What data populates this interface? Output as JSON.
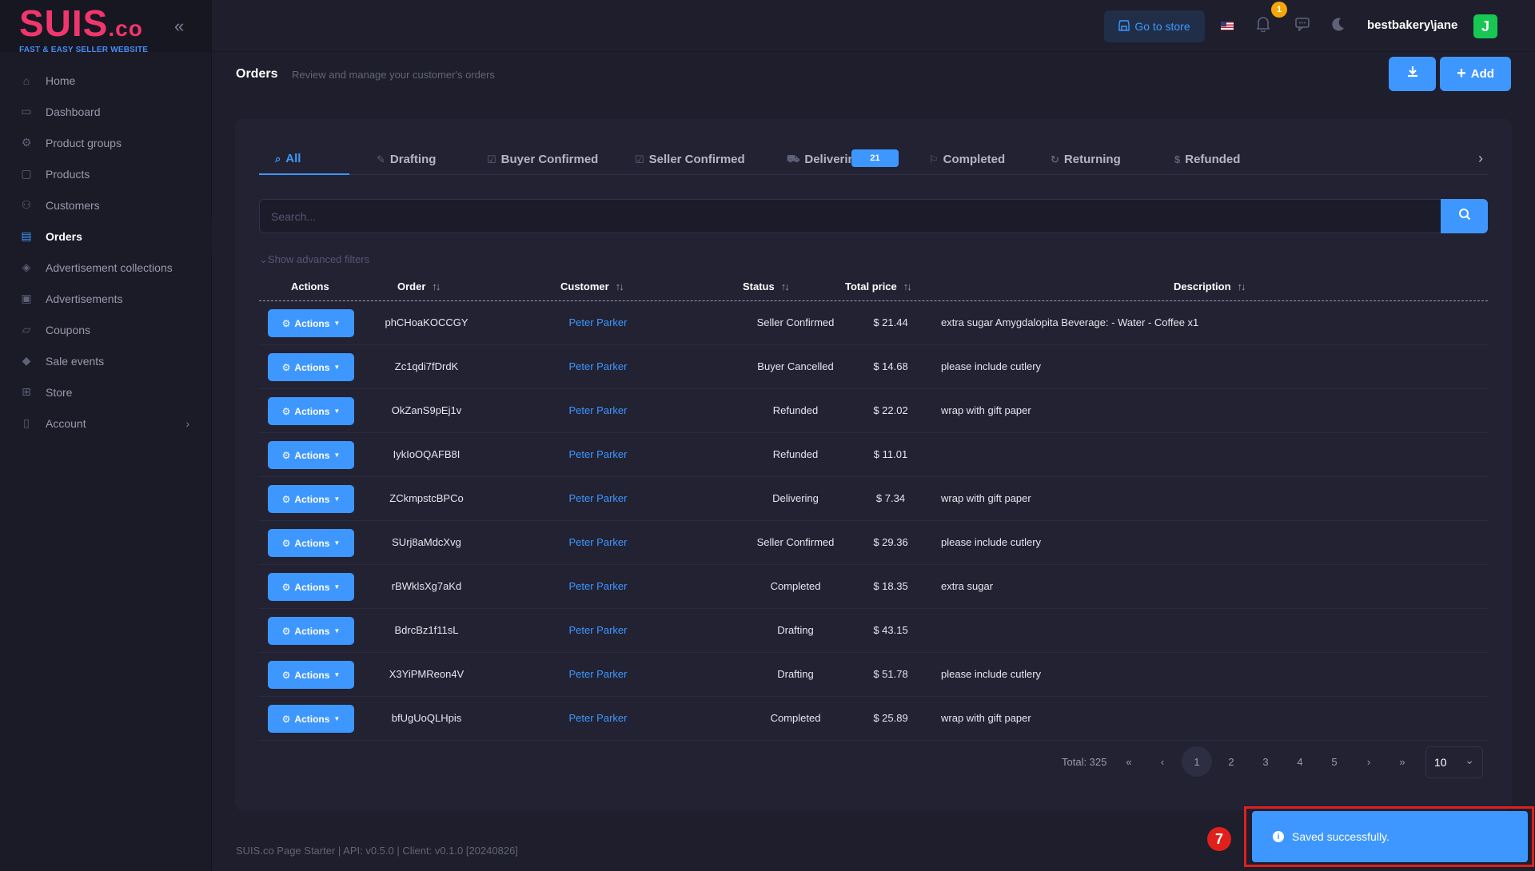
{
  "brand": {
    "logo_main": "SUIS",
    "logo_suffix": ".co",
    "tagline": "FAST & EASY SELLER WEBSITE"
  },
  "sidebar": {
    "collapse_icon": "chevrons-left-icon",
    "items": [
      {
        "label": "Home",
        "icon": "home-icon"
      },
      {
        "label": "Dashboard",
        "icon": "dashboard-icon"
      },
      {
        "label": "Product groups",
        "icon": "product-groups-icon"
      },
      {
        "label": "Products",
        "icon": "products-icon"
      },
      {
        "label": "Customers",
        "icon": "customers-icon"
      },
      {
        "label": "Orders",
        "icon": "orders-icon",
        "active": true
      },
      {
        "label": "Advertisement collections",
        "icon": "ad-collections-icon"
      },
      {
        "label": "Advertisements",
        "icon": "advertisements-icon"
      },
      {
        "label": "Coupons",
        "icon": "coupons-icon"
      },
      {
        "label": "Sale events",
        "icon": "sale-events-icon"
      },
      {
        "label": "Store",
        "icon": "store-icon"
      },
      {
        "label": "Account",
        "icon": "account-icon",
        "has_submenu": true
      }
    ]
  },
  "header": {
    "go_to_store": "Go to store",
    "notification_count": "1",
    "user": "bestbakery\\jane",
    "avatar_letter": "J"
  },
  "toolbar": {
    "title": "Orders",
    "description": "Review and manage your customer's orders",
    "add_label": "Add"
  },
  "tabs": [
    {
      "label": "All",
      "icon": "search-icon",
      "active": true
    },
    {
      "label": "Drafting",
      "icon": "pencil-icon"
    },
    {
      "label": "Buyer Confirmed",
      "icon": "check-square-icon"
    },
    {
      "label": "Seller Confirmed",
      "icon": "check-square-icon"
    },
    {
      "label": "Delivering",
      "icon": "truck-icon",
      "badge": "21"
    },
    {
      "label": "Completed",
      "icon": "flag-icon"
    },
    {
      "label": "Returning",
      "icon": "rotate-icon"
    },
    {
      "label": "Refunded",
      "icon": "dollar-icon"
    }
  ],
  "search": {
    "placeholder": "Search..."
  },
  "advanced_filters": "Show advanced filters",
  "table": {
    "headers": {
      "actions": "Actions",
      "order": "Order",
      "customer": "Customer",
      "status": "Status",
      "total_price": "Total price",
      "description": "Description"
    },
    "action_label": "Actions",
    "rows": [
      {
        "order": "phCHoaKOCCGY",
        "customer": "Peter Parker",
        "status": "Seller Confirmed",
        "price": "$ 21.44",
        "description": "extra sugar Amygdalopita Beverage: - Water - Coffee x1"
      },
      {
        "order": "Zc1qdi7fDrdK",
        "customer": "Peter Parker",
        "status": "Buyer Cancelled",
        "price": "$ 14.68",
        "description": "please include cutlery"
      },
      {
        "order": "OkZanS9pEj1v",
        "customer": "Peter Parker",
        "status": "Refunded",
        "price": "$ 22.02",
        "description": "wrap with gift paper"
      },
      {
        "order": "IykIoOQAFB8I",
        "customer": "Peter Parker",
        "status": "Refunded",
        "price": "$ 11.01",
        "description": ""
      },
      {
        "order": "ZCkmpstcBPCo",
        "customer": "Peter Parker",
        "status": "Delivering",
        "price": "$ 7.34",
        "description": "wrap with gift paper"
      },
      {
        "order": "SUrj8aMdcXvg",
        "customer": "Peter Parker",
        "status": "Seller Confirmed",
        "price": "$ 29.36",
        "description": "please include cutlery"
      },
      {
        "order": "rBWklsXg7aKd",
        "customer": "Peter Parker",
        "status": "Completed",
        "price": "$ 18.35",
        "description": "extra sugar"
      },
      {
        "order": "BdrcBz1f11sL",
        "customer": "Peter Parker",
        "status": "Drafting",
        "price": "$ 43.15",
        "description": ""
      },
      {
        "order": "X3YiPMReon4V",
        "customer": "Peter Parker",
        "status": "Drafting",
        "price": "$ 51.78",
        "description": "please include cutlery"
      },
      {
        "order": "bfUgUoQLHpis",
        "customer": "Peter Parker",
        "status": "Completed",
        "price": "$ 25.89",
        "description": "wrap with gift paper"
      }
    ]
  },
  "pagination": {
    "total": "Total: 325",
    "pages": [
      "1",
      "2",
      "3",
      "4",
      "5"
    ],
    "current_page": "1",
    "per_page": "10"
  },
  "footer": "SUIS.co Page Starter | API: v0.5.0 | Client: v0.1.0 [20240826]",
  "toast": {
    "message": "Saved successfully.",
    "annotation_number": "7"
  },
  "colors": {
    "accent": "#3e97ff",
    "brand": "#f0366d",
    "warning": "#f6a609",
    "success": "#17c653",
    "annotation": "#e0201b"
  }
}
